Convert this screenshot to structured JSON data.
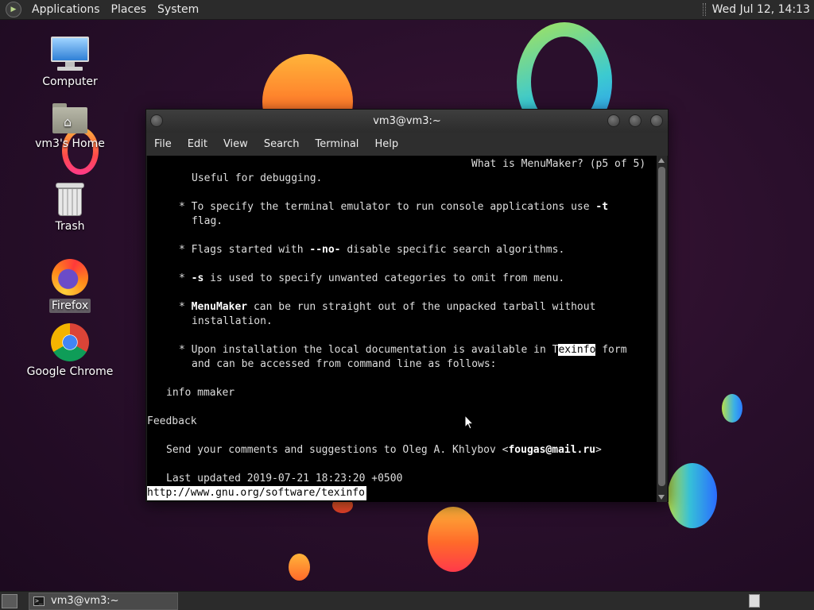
{
  "top_panel": {
    "menus": [
      "Applications",
      "Places",
      "System"
    ],
    "clock": "Wed Jul 12, 14:13"
  },
  "desktop": {
    "icons": [
      {
        "label": "Computer",
        "icon": "computer-icon"
      },
      {
        "label": "vm3's Home",
        "icon": "home-folder-icon"
      },
      {
        "label": "Trash",
        "icon": "trash-icon"
      },
      {
        "label": "Firefox",
        "icon": "firefox-icon",
        "selected": true
      },
      {
        "label": "Google Chrome",
        "icon": "chrome-icon"
      }
    ]
  },
  "window": {
    "title": "vm3@vm3:~",
    "menu": [
      "File",
      "Edit",
      "View",
      "Search",
      "Terminal",
      "Help"
    ]
  },
  "terminal": {
    "header": "What is MenuMaker? (p5 of 5)",
    "lines": [
      "Useful for debugging.",
      "To specify the terminal emulator to run console applications use",
      "-t",
      "flag.",
      "Flags started with",
      "--no-",
      "disable specific search algorithms.",
      "-s",
      "is used to specify unwanted categories to omit from menu.",
      "MenuMaker",
      "can be run straight out of the unpacked tarball without",
      "installation.",
      "Upon installation the local documentation is available in T",
      "exinfo",
      "form",
      "and can be accessed from command line as follows:",
      "info mmaker",
      "Feedback",
      "Send your comments and suggestions to Oleg A. Khlybov <",
      "fougas@mail.ru",
      ">",
      "Last updated 2019-07-21 18:23:20 +0500"
    ],
    "bullet": "*",
    "status_url": "http://www.gnu.org/software/texinfo"
  },
  "bottom_panel": {
    "task_label": "vm3@vm3:~"
  }
}
